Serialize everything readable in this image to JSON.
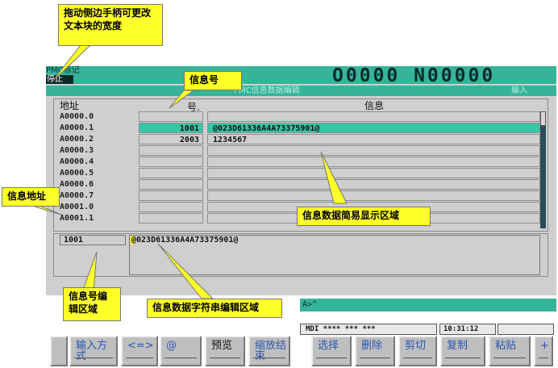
{
  "header": {
    "mode": "PMC标记",
    "status": "停止",
    "program_number": "O0000 N00000"
  },
  "screen": {
    "title": "PMC信息数据编辑",
    "input_tag": "输入"
  },
  "table": {
    "col_address": "地址",
    "col_number": "号.",
    "col_info": "信息",
    "rows": [
      {
        "address": "A0000.0",
        "number": "",
        "info": ""
      },
      {
        "address": "A0000.1",
        "number": "1001",
        "info": "@023D61336A4A73375901@"
      },
      {
        "address": "A0000.2",
        "number": "2003",
        "info": "1234567"
      },
      {
        "address": "A0000.3",
        "number": "",
        "info": ""
      },
      {
        "address": "A0000.4",
        "number": "",
        "info": ""
      },
      {
        "address": "A0000.5",
        "number": "",
        "info": ""
      },
      {
        "address": "A0000.6",
        "number": "",
        "info": ""
      },
      {
        "address": "A0000.7",
        "number": "",
        "info": ""
      },
      {
        "address": "A0001.0",
        "number": "",
        "info": ""
      },
      {
        "address": "A0001.1",
        "number": "",
        "info": ""
      }
    ],
    "selected_row": 1
  },
  "edit": {
    "number_value": "1001",
    "string_value": "@023D61336A4A73375901@"
  },
  "bottom": {
    "prompt": "A>^",
    "status": "MDI **** *** ***",
    "time": "10:31:12"
  },
  "softkeys": [
    {
      "label": "输入方式",
      "dark": false
    },
    {
      "label": "<=>",
      "dark": false
    },
    {
      "label": "@",
      "dark": false
    },
    {
      "label": "预览",
      "dark": true
    },
    {
      "label": "缩放结束",
      "dark": false
    },
    {
      "label": "选择",
      "dark": false
    },
    {
      "label": "删除",
      "dark": false
    },
    {
      "label": "剪切",
      "dark": false
    },
    {
      "label": "复制",
      "dark": false
    },
    {
      "label": "粘贴",
      "dark": false
    },
    {
      "label": "+",
      "dark": false
    }
  ],
  "callouts": {
    "handle": "拖动侧边手柄可更改文本块的宽度",
    "info_number": "信息号",
    "info_address": "信息地址",
    "display_area": "信息数据简易显示区域",
    "number_edit": "信息号编辑区域",
    "string_edit": "信息数据字符串编辑区域"
  },
  "colors": {
    "accent": "#35b49a",
    "callout": "#ffff2a",
    "softkey_text": "#2b56b0"
  }
}
